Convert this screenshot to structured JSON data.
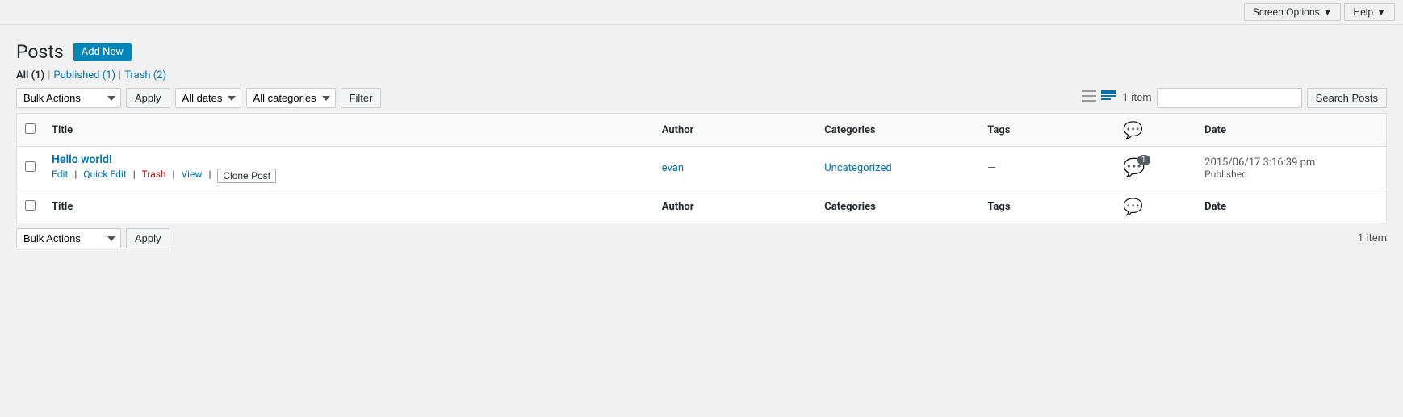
{
  "topbar": {
    "screen_options_label": "Screen Options",
    "help_label": "Help"
  },
  "header": {
    "title": "Posts",
    "add_new_label": "Add New"
  },
  "filter_links": {
    "all_label": "All",
    "all_count": "(1)",
    "published_label": "Published",
    "published_count": "(1)",
    "trash_label": "Trash",
    "trash_count": "(2)"
  },
  "top_tablenav": {
    "bulk_actions_label": "Bulk Actions",
    "apply_label": "Apply",
    "date_default": "All dates",
    "cat_default": "All categories",
    "filter_label": "Filter",
    "item_count_text": "1 item",
    "search_input_placeholder": "",
    "search_posts_label": "Search Posts"
  },
  "table": {
    "col_title": "Title",
    "col_author": "Author",
    "col_categories": "Categories",
    "col_tags": "Tags",
    "col_date": "Date",
    "rows": [
      {
        "title": "Hello world!",
        "edit_label": "Edit",
        "quick_edit_label": "Quick Edit",
        "trash_label": "Trash",
        "view_label": "View",
        "clone_post_label": "Clone Post",
        "author": "evan",
        "categories": "Uncategorized",
        "tags": "—",
        "comment_count": "1",
        "date": "2015/06/17 3:16:39 pm",
        "status": "Published"
      }
    ]
  },
  "bottom_tablenav": {
    "bulk_actions_label": "Bulk Actions",
    "apply_label": "Apply",
    "item_count_text": "1 item"
  }
}
